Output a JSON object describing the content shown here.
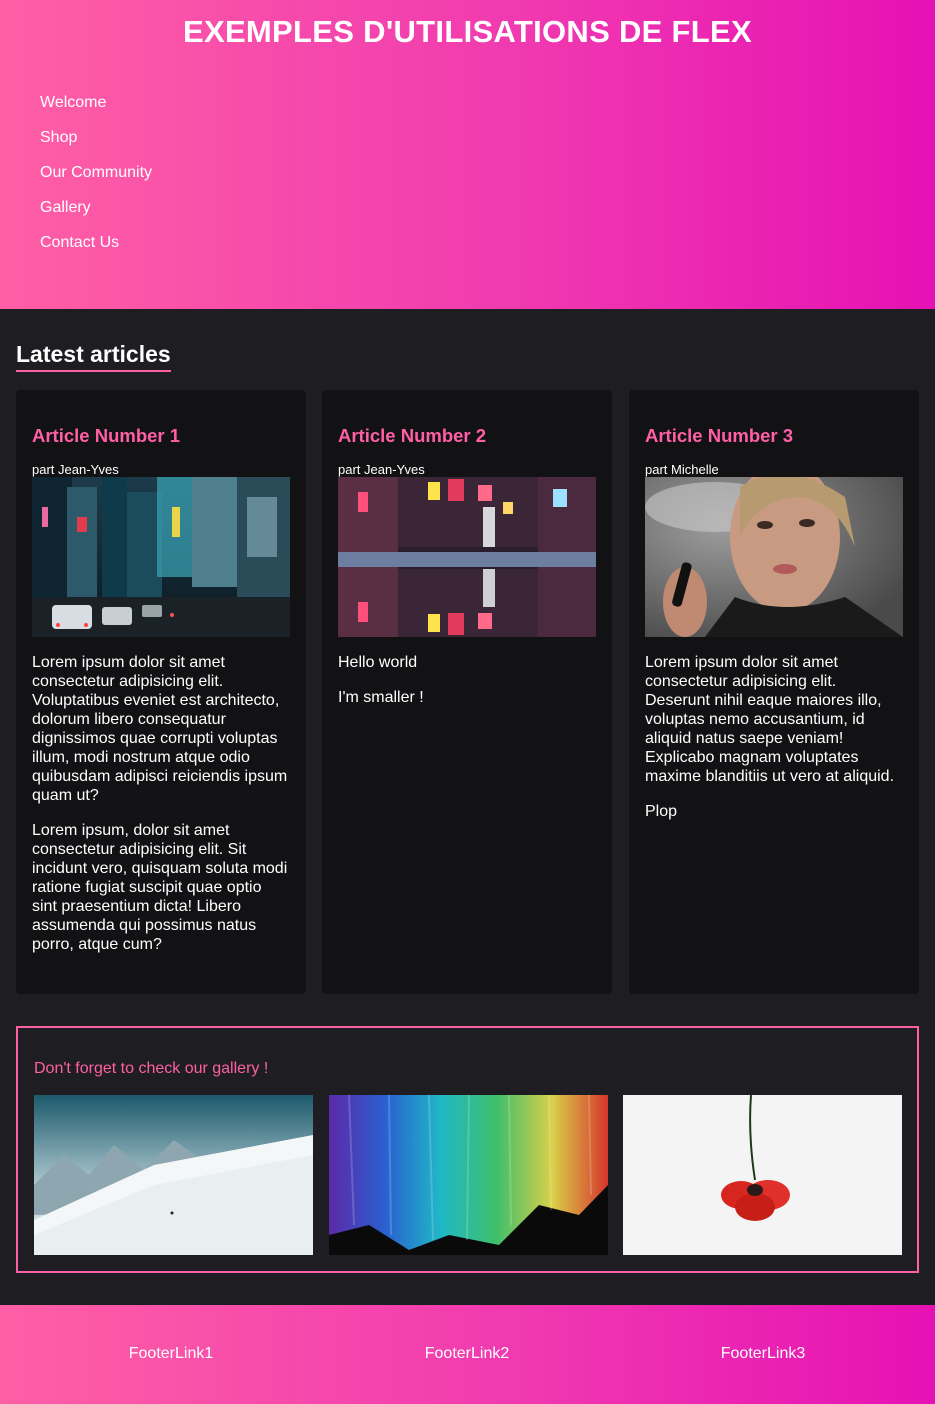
{
  "header": {
    "title": "EXEMPLES D'UTILISATIONS DE FLEX",
    "nav": [
      "Welcome",
      "Shop",
      "Our Community",
      "Gallery",
      "Contact Us"
    ]
  },
  "articles_section": {
    "title": "Latest articles",
    "articles": [
      {
        "title": "Article Number 1",
        "author": "part Jean-Yves",
        "image": "city-street-night-photo",
        "paragraphs": [
          "Lorem ipsum dolor sit amet consectetur adipisicing elit. Voluptatibus eveniet est architecto, dolorum libero consequatur dignissimos quae corrupti voluptas illum, modi nostrum atque odio quibusdam adipisci reiciendis ipsum quam ut?",
          "Lorem ipsum, dolor sit amet consectetur adipisicing elit. Sit incidunt vero, quisquam soluta modi ratione fugiat suscipit quae optio sint praesentium dicta! Libero assumenda qui possimus natus porro, atque cum?"
        ]
      },
      {
        "title": "Article Number 2",
        "author": "part Jean-Yves",
        "image": "neon-street-reflection-photo",
        "paragraphs": [
          "Hello world",
          "I'm smaller !"
        ]
      },
      {
        "title": "Article Number 3",
        "author": "part Michelle",
        "image": "woman-vaping-portrait-photo",
        "paragraphs": [
          "Lorem ipsum dolor sit amet consectetur adipisicing elit. Deserunt nihil eaque maiores illo, voluptas nemo accusantium, id aliquid natus saepe veniam! Explicabo magnam voluptates maxime blanditiis ut vero at aliquid.",
          "Plop"
        ]
      }
    ]
  },
  "gallery": {
    "title": "Don't forget to check our gallery !",
    "images": [
      "snowy-mountain-photo",
      "rainbow-paint-photo",
      "red-poppy-photo"
    ]
  },
  "footer": {
    "links": [
      "FooterLink1",
      "FooterLink2",
      "FooterLink3"
    ]
  },
  "colors": {
    "accent": "#ff5fa5",
    "gradient_end": "#e611b4",
    "page_bg": "#1e1e22",
    "card_bg": "#121214"
  }
}
